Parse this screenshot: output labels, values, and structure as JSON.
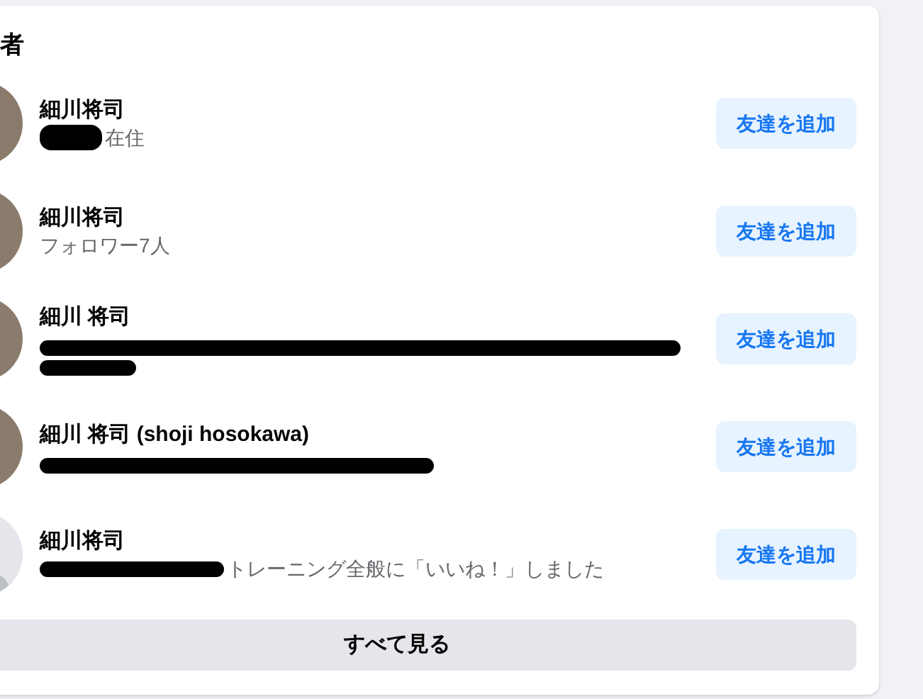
{
  "heading": "者",
  "people": [
    {
      "name": "細川将司",
      "avatar": {
        "kind": "photo"
      },
      "redaction": {
        "kind": "short"
      },
      "detail": "在住",
      "button": "友達を追加"
    },
    {
      "name": "細川将司",
      "avatar": {
        "kind": "photo"
      },
      "detail": "フォロワー7人",
      "button": "友達を追加"
    },
    {
      "name": "細川 将司",
      "avatar": {
        "kind": "photo"
      },
      "redaction": {
        "kind": "wrap"
      },
      "button": "友達を追加"
    },
    {
      "name": "細川 将司 (shoji hosokawa)",
      "avatar": {
        "kind": "photo"
      },
      "redaction": {
        "kind": "long"
      },
      "button": "友達を追加"
    },
    {
      "name": "細川将司",
      "avatar": {
        "kind": "default"
      },
      "redaction": {
        "kind": "medium"
      },
      "detail": "トレーニング全般に「いいね！」しました",
      "button": "友達を追加"
    }
  ],
  "see_all": "すべて見る"
}
